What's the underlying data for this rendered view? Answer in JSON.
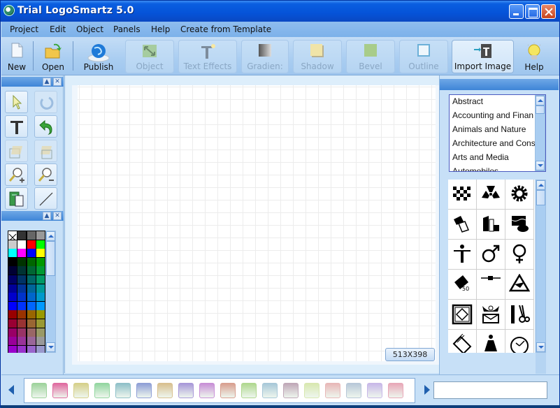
{
  "window": {
    "title": "Trial LogoSmartz 5.0"
  },
  "menu": [
    "Project",
    "Edit",
    "Object",
    "Panels",
    "Help",
    "Create from Template"
  ],
  "toolbar": {
    "new": "New",
    "open": "Open",
    "publish": "Publish",
    "object": "Object",
    "text_effects": "Text Effects",
    "gradient": "Gradien:",
    "shadow": "Shadow",
    "bevel": "Bevel",
    "outline": "Outline",
    "import_image": "Import Image",
    "help": "Help"
  },
  "tools": [
    {
      "name": "select-arrow",
      "enabled": true
    },
    {
      "name": "rotate",
      "enabled": false
    },
    {
      "name": "text",
      "enabled": true
    },
    {
      "name": "undo",
      "enabled": true
    },
    {
      "name": "bring-forward",
      "enabled": false
    },
    {
      "name": "send-backward",
      "enabled": false
    },
    {
      "name": "zoom-in",
      "enabled": true
    },
    {
      "name": "zoom-out",
      "enabled": true
    },
    {
      "name": "clipboard",
      "enabled": true
    },
    {
      "name": "line",
      "enabled": true
    }
  ],
  "palette": {
    "colors": [
      "none",
      "#333333",
      "#666666",
      "#999999",
      "#cccccc",
      "#ffffff",
      "#ff0000",
      "#00ff00",
      "#00ffff",
      "#ff00ff",
      "#0000ff",
      "#ffff00",
      "#000000",
      "#003300",
      "#006600",
      "#009900",
      "#000033",
      "#003333",
      "#006633",
      "#009933",
      "#000066",
      "#003366",
      "#006666",
      "#009966",
      "#000099",
      "#003399",
      "#006699",
      "#009999",
      "#0000cc",
      "#0033cc",
      "#0066cc",
      "#0099cc",
      "#0000ff",
      "#0033ff",
      "#0066ff",
      "#0099ff",
      "#990000",
      "#993300",
      "#996600",
      "#999900",
      "#990033",
      "#993333",
      "#996633",
      "#999933",
      "#990066",
      "#993366",
      "#996666",
      "#999966",
      "#990099",
      "#993399",
      "#996699",
      "#999999",
      "#9900cc",
      "#9933cc",
      "#9966cc",
      "#9999cc",
      "#9900ff",
      "#9933ff",
      "#9966ff",
      "#9999ff"
    ]
  },
  "canvas": {
    "size_label": "513X398"
  },
  "categories": [
    "Abstract",
    "Accounting and Finan",
    "Animals and Nature",
    "Architecture and Cons",
    "Arts and Media",
    "Automobiles"
  ],
  "symbols": [
    "checker",
    "radiation",
    "gear",
    "documents",
    "buildings",
    "cans",
    "human",
    "male",
    "female",
    "badge-100",
    "connector",
    "triangle-emblem",
    "framed-diamond",
    "post-horn",
    "comb-scissors",
    "stack",
    "woman",
    "clock"
  ],
  "styles": [
    "#9ed39c",
    "#e06ba0",
    "#d6d08a",
    "#93d6a0",
    "#8fc0c8",
    "#8f9fd6",
    "#d8c08f",
    "#a898d8",
    "#c88fd6",
    "#d89f8f",
    "#b0d88f",
    "#a8c8d8",
    "#c0a8b8",
    "#d8e8b0",
    "#e8b8b8",
    "#b8c8d8",
    "#c8b8e8",
    "#e8a8b8"
  ],
  "text_input": {
    "value": ""
  }
}
